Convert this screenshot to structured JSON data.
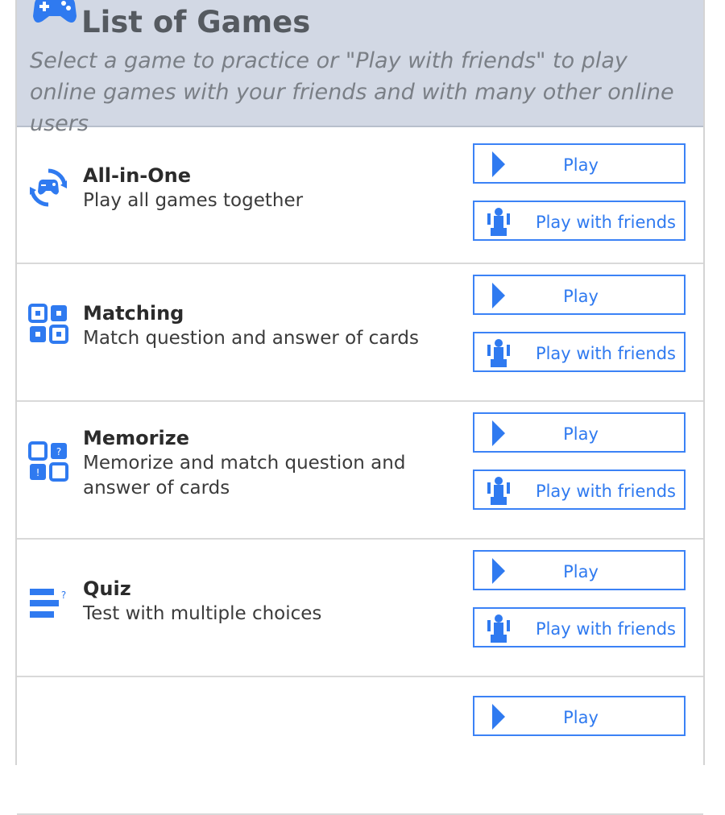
{
  "header": {
    "title": "List of Games",
    "subtitle": "Select a game to practice or \"Play with friends\" to play online games with your friends and with many other online users"
  },
  "games": [
    {
      "title": "All-in-One",
      "description": "Play all games together",
      "icon": "gamepad-cycle-icon",
      "play_label": "Play",
      "friends_label": "Play with friends"
    },
    {
      "title": "Matching",
      "description": "Match question and answer of cards",
      "icon": "matching-grid-icon",
      "play_label": "Play",
      "friends_label": "Play with friends"
    },
    {
      "title": "Memorize",
      "description": "Memorize and match question and answer of cards",
      "icon": "memorize-grid-icon",
      "play_label": "Play",
      "friends_label": "Play with friends"
    },
    {
      "title": "Quiz",
      "description": "Test with multiple choices",
      "icon": "quiz-list-icon",
      "play_label": "Play",
      "friends_label": "Play with friends"
    },
    {
      "title": "",
      "description": "",
      "icon": "",
      "play_label": "Play",
      "friends_label": ""
    }
  ],
  "colors": {
    "accent": "#2f7af0",
    "header_bg": "#d2d8e4"
  }
}
